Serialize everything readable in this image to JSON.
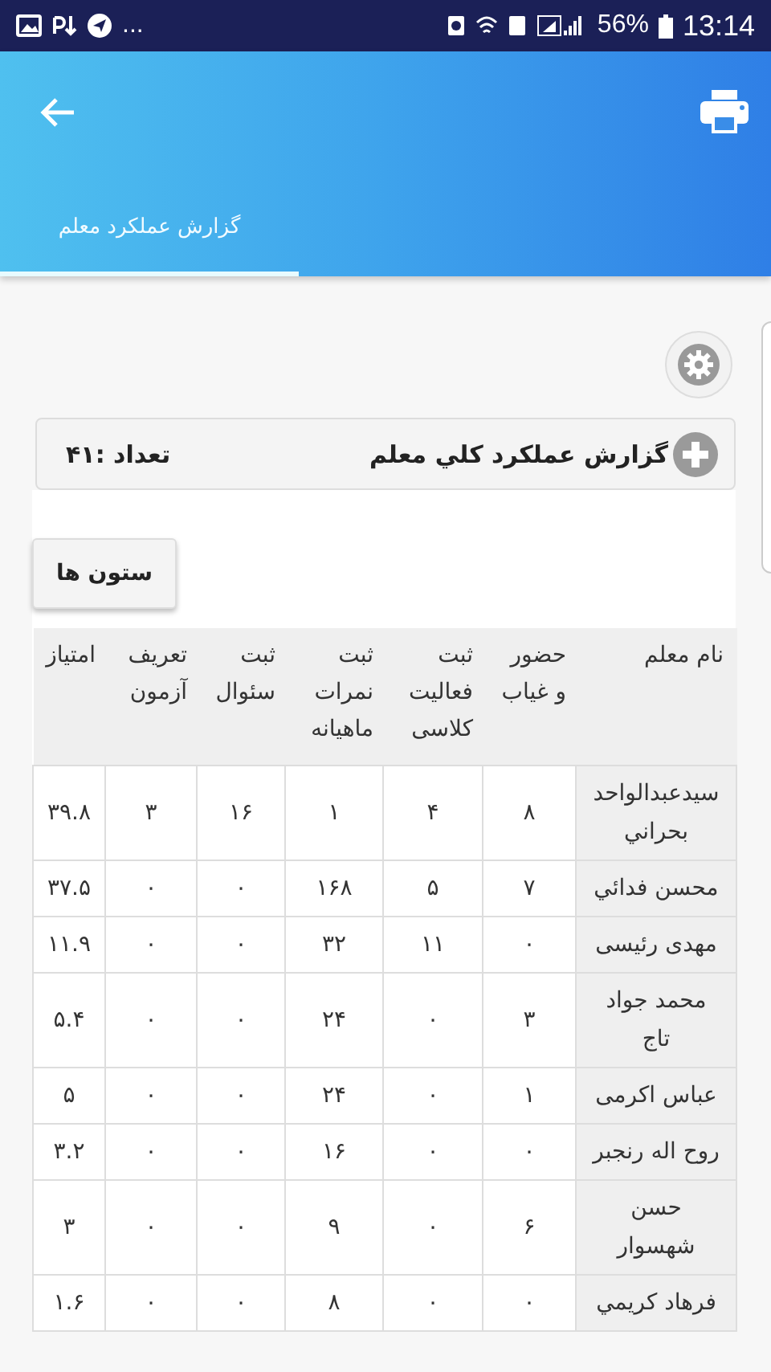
{
  "status_bar": {
    "left_text": "...",
    "battery": "56%",
    "time": "13:14"
  },
  "app_bar": {
    "tabs": [
      {
        "label": "گزارش عملکرد معلم",
        "selected": true
      }
    ]
  },
  "report": {
    "title": "گزارش عملکرد كلي معلم",
    "count": "تعداد :۴۱",
    "columns_button": "ستون ها",
    "columns": [
      "نام معلم",
      "حضور و غیاب",
      "ثبت فعالیت کلاسی",
      "ثبت نمرات ماهیانه",
      "ثبت سئوال",
      "تعریف آزمون",
      "امتیاز"
    ],
    "rows": [
      {
        "name": "سیدعبدالواحد بحراني",
        "values": [
          "۸",
          "۴",
          "۱",
          "۱۶",
          "۳",
          "۳۹.۸"
        ]
      },
      {
        "name": "محسن فدائي",
        "values": [
          "۷",
          "۵",
          "۱۶۸",
          "۰",
          "۰",
          "۳۷.۵"
        ]
      },
      {
        "name": "مهدی رئیسی",
        "values": [
          "۰",
          "۱۱",
          "۳۲",
          "۰",
          "۰",
          "۱۱.۹"
        ]
      },
      {
        "name": "محمد جواد تاج",
        "values": [
          "۳",
          "۰",
          "۲۴",
          "۰",
          "۰",
          "۵.۴"
        ]
      },
      {
        "name": "عباس اکرمی",
        "values": [
          "۱",
          "۰",
          "۲۴",
          "۰",
          "۰",
          "۵"
        ]
      },
      {
        "name": "روح اله رنجبر",
        "values": [
          "۰",
          "۰",
          "۱۶",
          "۰",
          "۰",
          "۳.۲"
        ]
      },
      {
        "name": "حسن شهسوار",
        "values": [
          "۶",
          "۰",
          "۹",
          "۰",
          "۰",
          "۳"
        ]
      },
      {
        "name": "فرهاد کریمي",
        "values": [
          "۰",
          "۰",
          "۸",
          "۰",
          "۰",
          "۱.۶"
        ]
      }
    ]
  }
}
